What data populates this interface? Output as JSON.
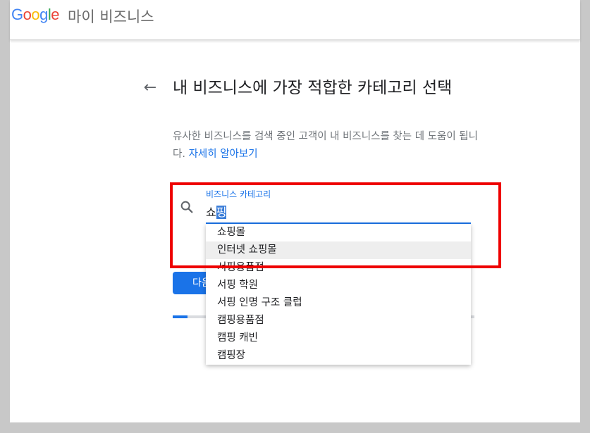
{
  "header": {
    "logo_letters": [
      "G",
      "o",
      "o",
      "g",
      "l",
      "e"
    ],
    "logo_colors": [
      "#4285F4",
      "#EA4335",
      "#FBBC05",
      "#4285F4",
      "#34A853",
      "#EA4335"
    ],
    "product_name": "마이 비즈니스"
  },
  "main": {
    "back_icon": "←",
    "title": "내 비즈니스에 가장 적합한 카테고리 선택",
    "subtitle": "유사한 비즈니스를 검색 중인 고객이 내 비즈니스를 찾는 데 도움이 됩니다.",
    "learn_more": "자세히 알아보기",
    "field_label": "비즈니스 카테고리",
    "input_typed": "쇼",
    "input_selected": "핑",
    "next_button": "다음",
    "progress": 0.05
  },
  "dropdown": {
    "items": [
      "쇼핑몰",
      "인터넷 쇼핑몰",
      "서핑용품점",
      "서핑 학원",
      "서핑 인명 구조 클럽",
      "캠핑용품점",
      "캠핑 캐빈",
      "캠핑장"
    ],
    "active_index": 1
  },
  "colors": {
    "accent": "#1a73e8",
    "annotation": "#ee0000"
  }
}
